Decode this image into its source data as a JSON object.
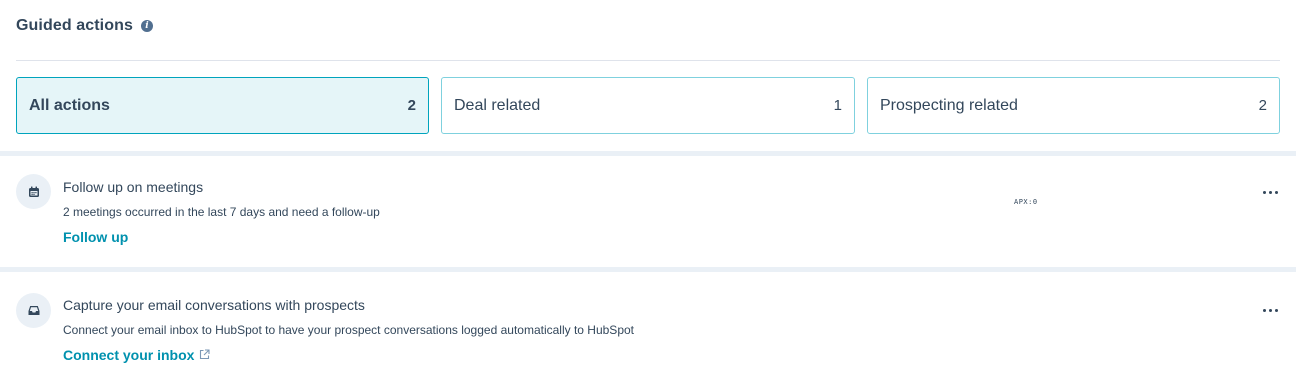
{
  "header": {
    "title": "Guided actions",
    "info_icon": "info-icon"
  },
  "filters": [
    {
      "label": "All actions",
      "count": "2",
      "active": true
    },
    {
      "label": "Deal related",
      "count": "1",
      "active": false
    },
    {
      "label": "Prospecting related",
      "count": "2",
      "active": false
    }
  ],
  "actions": [
    {
      "icon": "calendar-icon",
      "title": "Follow up on meetings",
      "description": "2 meetings occurred in the last 7 days and need a follow-up",
      "link_label": "Follow up",
      "stray_text": "APX:0"
    },
    {
      "icon": "inbox-icon",
      "title": "Capture your email conversations with prospects",
      "description": "Connect your email inbox to HubSpot to have your prospect conversations logged automatically to HubSpot",
      "link_label": "Connect your inbox",
      "link_icon": "external-link-icon"
    }
  ],
  "colors": {
    "accent": "#00a4bd",
    "link": "#0091ae",
    "text": "#33475b",
    "active_bg": "#e5f5f8",
    "separator": "#eaf0f6"
  }
}
